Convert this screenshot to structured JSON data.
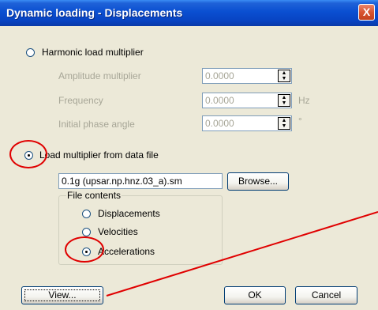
{
  "window": {
    "title": "Dynamic loading - Displacements",
    "close_label": "X"
  },
  "harmonic": {
    "label": "Harmonic load multiplier",
    "selected": false,
    "amplitude": {
      "label": "Amplitude multiplier",
      "value": "0.0000",
      "unit": ""
    },
    "frequency": {
      "label": "Frequency",
      "value": "0.0000",
      "unit": "Hz"
    },
    "phase": {
      "label": "Initial phase angle",
      "value": "0.0000",
      "unit": "°"
    }
  },
  "datafile": {
    "label": "Load multiplier from data file",
    "selected": true,
    "filename": "0.1g (upsar.np.hnz.03_a).sm",
    "browse_label": "Browse...",
    "contents": {
      "legend": "File contents",
      "options": [
        {
          "label": "Displacements",
          "selected": false
        },
        {
          "label": "Velocities",
          "selected": false
        },
        {
          "label": "Accelerations",
          "selected": true
        }
      ]
    }
  },
  "buttons": {
    "view_label": "View...",
    "ok_label": "OK",
    "cancel_label": "Cancel"
  },
  "colors": {
    "annotation": "#e00000",
    "titlebar": "#0a4fd1",
    "dialog_bg": "#ece9d8"
  }
}
